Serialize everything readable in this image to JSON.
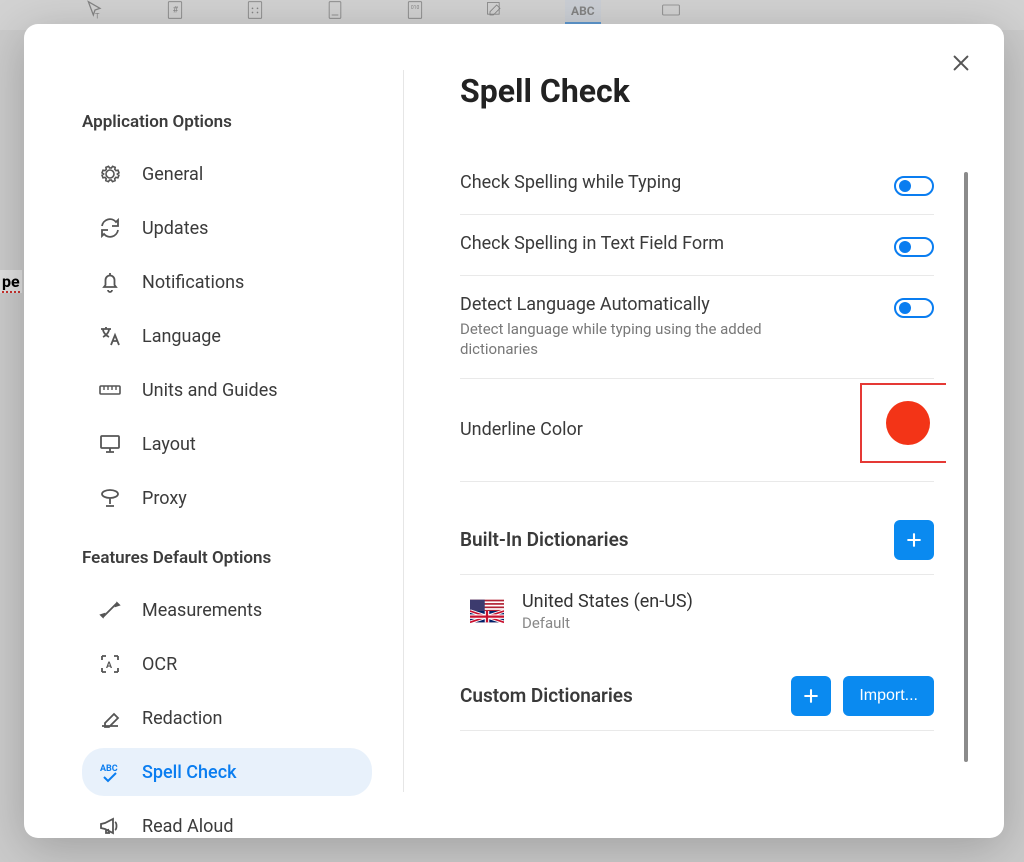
{
  "sidebar": {
    "heading_app": "Application Options",
    "heading_feat": "Features Default Options",
    "app_items": [
      {
        "label": "General",
        "name": "sidebar-item-general",
        "icon": "gear-icon"
      },
      {
        "label": "Updates",
        "name": "sidebar-item-updates",
        "icon": "sync-icon"
      },
      {
        "label": "Notifications",
        "name": "sidebar-item-notifications",
        "icon": "bell-icon"
      },
      {
        "label": "Language",
        "name": "sidebar-item-language",
        "icon": "translate-icon"
      },
      {
        "label": "Units and Guides",
        "name": "sidebar-item-units",
        "icon": "ruler-icon"
      },
      {
        "label": "Layout",
        "name": "sidebar-item-layout",
        "icon": "monitor-icon"
      },
      {
        "label": "Proxy",
        "name": "sidebar-item-proxy",
        "icon": "proxy-icon"
      }
    ],
    "feat_items": [
      {
        "label": "Measurements",
        "name": "sidebar-item-measurements",
        "icon": "measure-icon"
      },
      {
        "label": "OCR",
        "name": "sidebar-item-ocr",
        "icon": "ocr-icon"
      },
      {
        "label": "Redaction",
        "name": "sidebar-item-redaction",
        "icon": "eraser-icon"
      },
      {
        "label": "Spell Check",
        "name": "sidebar-item-spellcheck",
        "icon": "spellcheck-icon",
        "active": true
      },
      {
        "label": "Read Aloud",
        "name": "sidebar-item-readaloud",
        "icon": "megaphone-icon"
      }
    ]
  },
  "content": {
    "title": "Spell Check",
    "rows": {
      "checkTyping": {
        "label": "Check Spelling while Typing",
        "on": true
      },
      "checkForm": {
        "label": "Check Spelling in Text Field Form",
        "on": true
      },
      "detectLang": {
        "label": "Detect Language Automatically",
        "sub": "Detect language while typing using the added dictionaries",
        "on": true
      },
      "underlineColor": {
        "label": "Underline Color",
        "color": "#f33417"
      }
    },
    "builtin": {
      "title": "Built-In Dictionaries",
      "items": [
        {
          "name": "United States (en-US)",
          "meta": "Default"
        }
      ]
    },
    "custom": {
      "title": "Custom Dictionaries",
      "import_label": "Import..."
    }
  },
  "background": {
    "doc_text_fragment": "pe",
    "toolbar_abc": "ABC"
  }
}
